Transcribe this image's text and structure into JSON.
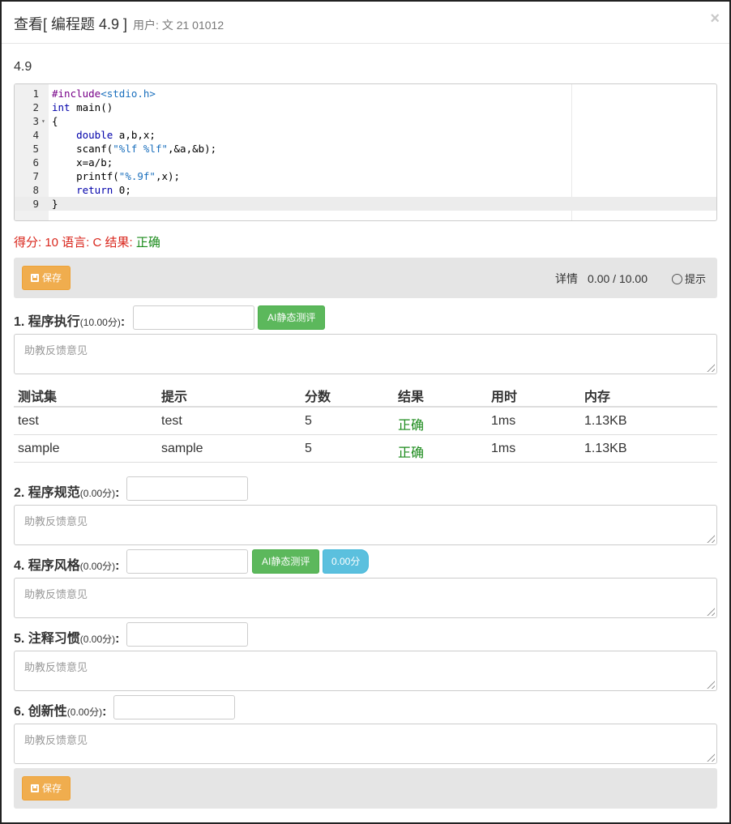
{
  "header": {
    "title": "查看[ 编程题 4.9 ]",
    "user_label": "用户: 文   21      01012",
    "close_label": "×"
  },
  "question_name": "4.9",
  "editor": {
    "line_numbers": [
      "1",
      "2",
      "3",
      "4",
      "5",
      "6",
      "7",
      "8",
      "9"
    ],
    "fold_marker": "▾"
  },
  "result": {
    "prefix": "得分: 10 语言: C 结果: ",
    "status": "正确"
  },
  "toolbar": {
    "save_label": "保存",
    "detail_label": "详情",
    "detail_value": "0.00 / 10.00",
    "hint_label": "提示"
  },
  "sections": {
    "s1": {
      "label": "1. 程序执行",
      "points": "(10.00分)",
      "colon": ":",
      "ai_label": "AI静态测评",
      "placeholder": "助教反馈意见"
    },
    "s2": {
      "label": "2. 程序规范",
      "points": "(0.00分)",
      "colon": ":",
      "placeholder": "助教反馈意见"
    },
    "s4": {
      "label": "4. 程序风格",
      "points": "(0.00分)",
      "colon": ":",
      "ai_label": "AI静态测评",
      "badge": "0.00分",
      "placeholder": "助教反馈意见"
    },
    "s5": {
      "label": "5. 注释习惯",
      "points": "(0.00分)",
      "colon": ":",
      "placeholder": "助教反馈意见"
    },
    "s6": {
      "label": "6. 创新性",
      "points": "(0.00分)",
      "colon": ":",
      "placeholder": "助教反馈意见"
    }
  },
  "table": {
    "headers": [
      "测试集",
      "提示",
      "分数",
      "结果",
      "用时",
      "内存"
    ],
    "rows": [
      [
        "test",
        "test",
        "5",
        "正确",
        "1ms",
        "1.13KB"
      ],
      [
        "sample",
        "sample",
        "5",
        "正确",
        "1ms",
        "1.13KB"
      ]
    ]
  },
  "footer": {
    "save_label": "保存"
  },
  "colors": {
    "accent_orange": "#f0ad4e",
    "success_green": "#5cb85c",
    "info_blue": "#5bc0de",
    "error_red": "#d9261c"
  }
}
